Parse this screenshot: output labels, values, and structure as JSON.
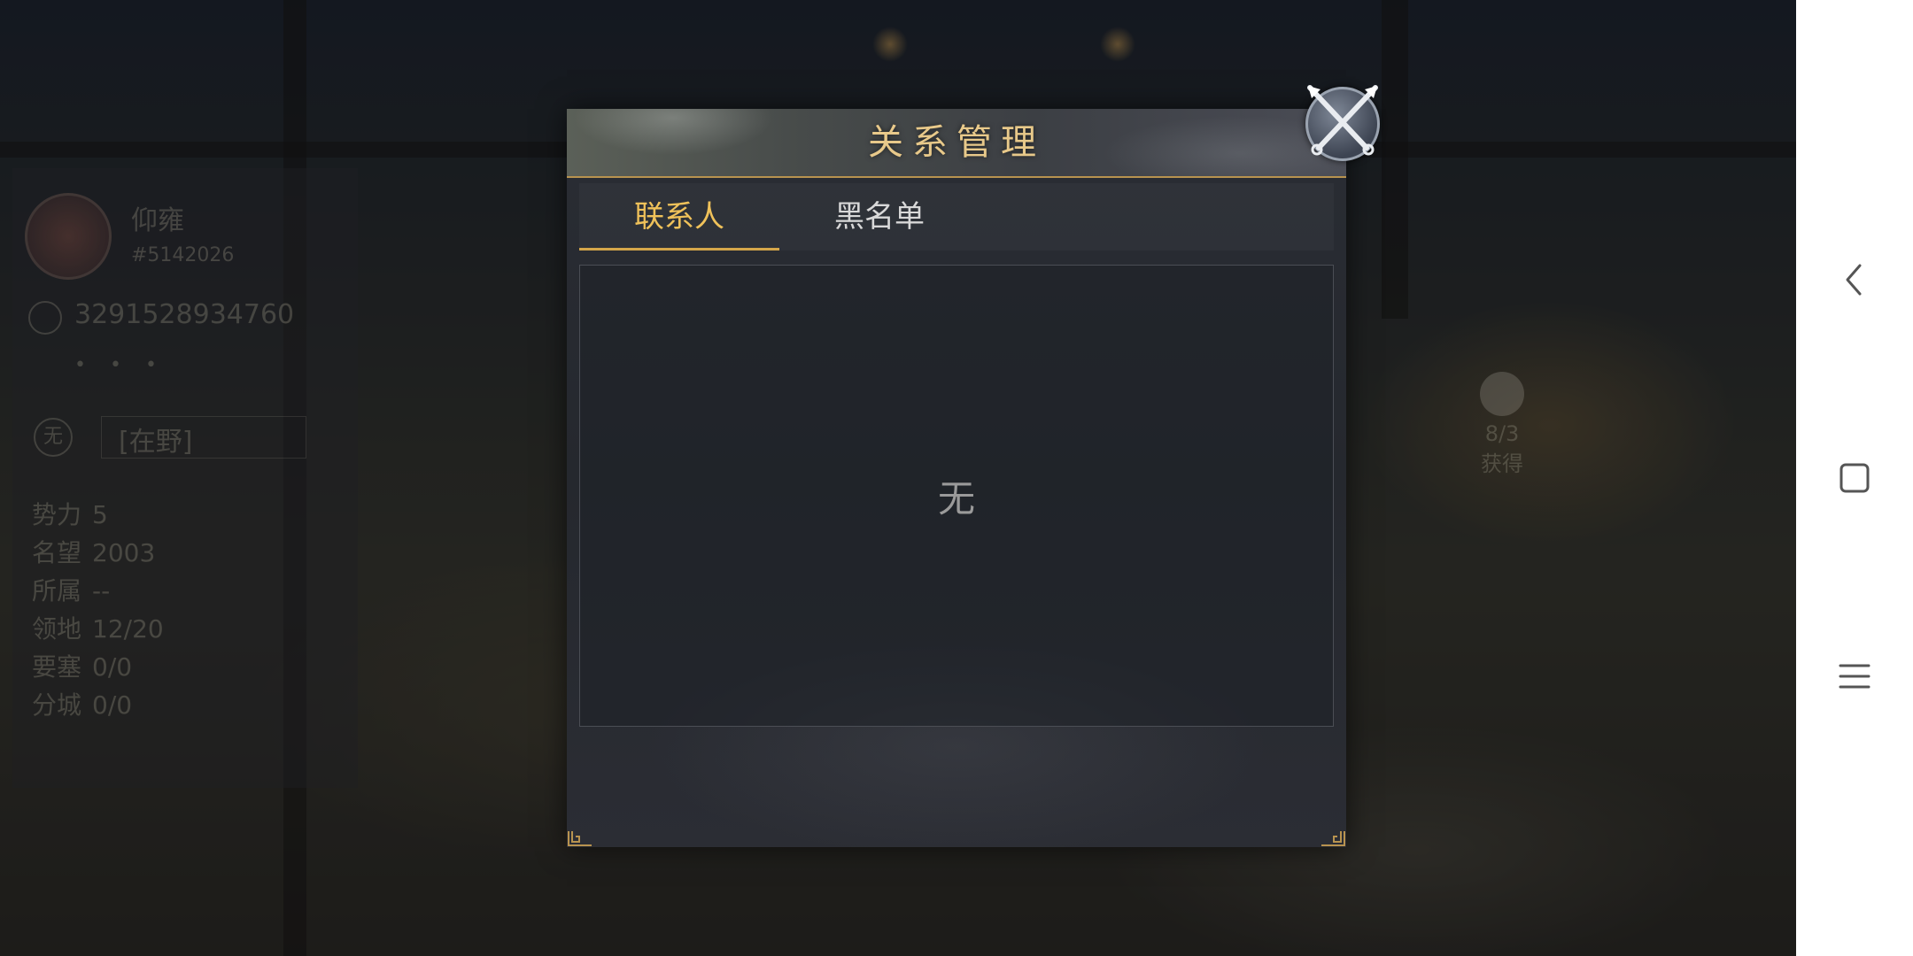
{
  "dialog": {
    "title": "关系管理",
    "tabs": [
      {
        "label": "联系人",
        "active": true
      },
      {
        "label": "黑名单",
        "active": false
      }
    ],
    "empty_text": "无"
  },
  "background_player": {
    "name": "仰雍",
    "subtitle": "#5142026",
    "id": "3291528934760",
    "dots": "• • •",
    "tag_icon": "无",
    "tag": "[在野]",
    "stats": [
      {
        "label": "势力",
        "value": "5"
      },
      {
        "label": "名望",
        "value": "2003"
      },
      {
        "label": "所属",
        "value": "--"
      },
      {
        "label": "领地",
        "value": "12/20"
      },
      {
        "label": "要塞",
        "value": "0/0"
      },
      {
        "label": "分城",
        "value": "0/0"
      }
    ]
  },
  "background_button": {
    "line1": "8/3",
    "line2": "获得"
  },
  "nav": {
    "icons": [
      "back-icon",
      "home-icon",
      "menu-icon"
    ]
  },
  "colors": {
    "accent": "#f0c25a",
    "title": "#e8c98a",
    "border": "#b8934f"
  }
}
